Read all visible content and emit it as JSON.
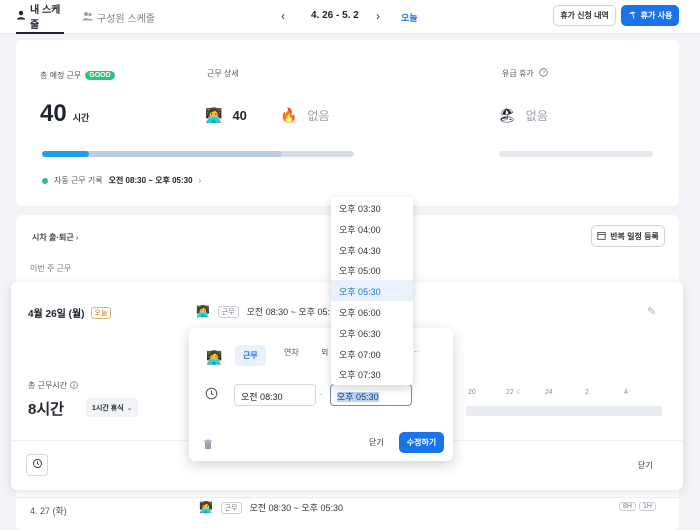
{
  "topbar": {
    "tab_my": "내 스케줄",
    "tab_team": "구성원 스케줄",
    "range": "4. 26 - 5. 2",
    "today": "오늘",
    "leave_history": "휴가 신청 내역",
    "use_leave": "휴가 사용"
  },
  "summary": {
    "total_label": "총 예정 근무",
    "good_badge": "GOOD",
    "total_value": "40",
    "total_unit": "시간",
    "detail_label": "근무 상세",
    "work_value": "40",
    "overtime_value": "없음",
    "leave_label": "유급 휴가",
    "leave_value": "없음",
    "auto_label": "자동 근무 기록",
    "auto_value": "오전 08:30 ~ 오후 05:30",
    "progress_dark": 0.15,
    "progress_light": 0.77
  },
  "schedule": {
    "flex_label": "시차 출·퇴근",
    "repeat_button": "반복 일정 등록",
    "this_week": "이번 주 근무",
    "day_title": "4월 26일 (월)",
    "today_tag": "오늘",
    "work_tag": "근무",
    "work_range": "오전 08:30 ~ 오후 05:",
    "total_time_label": "총 근무시간",
    "total_time_value": "8시간",
    "break_select": "1시간 휴식",
    "timeline_labels": [
      "20",
      "22",
      "24",
      "2",
      "4"
    ],
    "close_button": "닫기",
    "next_day": "4. 27 (화)",
    "next_work_tag": "근무",
    "next_range": "오전 08:30 ~ 오후 05:30",
    "badge_8h": "8H",
    "badge_1h": "1H"
  },
  "popover": {
    "tab_work": "근무",
    "tab_leave": "연차",
    "tab_out": "외",
    "start_time": "오전 08:30",
    "end_time": "오후 05:30",
    "close": "닫기",
    "submit": "수정하기"
  },
  "dropdown": {
    "options": [
      "오후 03:30",
      "오후 04:00",
      "오후 04:30",
      "오후 05:00",
      "오후 05:30",
      "오후 06:00",
      "오후 06:30",
      "오후 07:00",
      "오후 07:30"
    ],
    "selected_index": 4
  },
  "colors": {
    "accent": "#1a73e8",
    "good": "#2ec27e"
  }
}
